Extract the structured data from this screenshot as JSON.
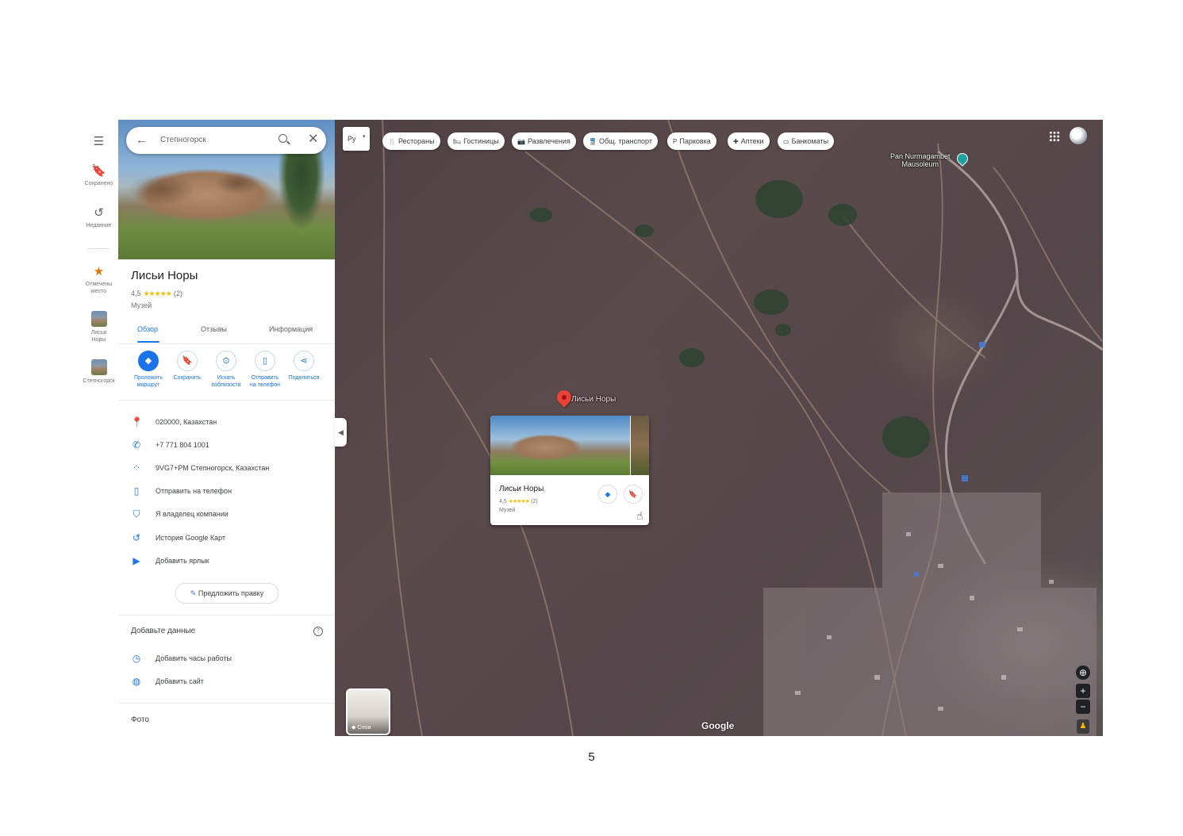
{
  "rail": {
    "menu_icon": "hamburger-menu-icon",
    "saved_label": "Сохранено",
    "recent_label": "Недавние",
    "marked_label": "Отмечены место",
    "place1_label": "Лисьи Норы",
    "place2_label": "Степногорск"
  },
  "search": {
    "query": "Степногорск"
  },
  "place": {
    "title": "Лисьи Норы",
    "rating": "4,5",
    "stars": "★★★★★",
    "review_count": "(2)",
    "category": "Музей"
  },
  "tabs": [
    "Обзор",
    "Отзывы",
    "Информация"
  ],
  "actions": [
    {
      "label1": "Проложить",
      "label2": "маршрут"
    },
    {
      "label1": "Сохранить",
      "label2": ""
    },
    {
      "label1": "Искать",
      "label2": "поблизости"
    },
    {
      "label1": "Отправить",
      "label2": "на телефон"
    },
    {
      "label1": "Поделиться",
      "label2": ""
    }
  ],
  "info": [
    {
      "icon": "location-pin-icon",
      "text": "020000, Казахстан"
    },
    {
      "icon": "phone-icon",
      "text": "+7 771 804 1001"
    },
    {
      "icon": "plus-code-icon",
      "text": "9VG7+PM Степногорск, Казахстан"
    },
    {
      "icon": "send-to-phone-icon",
      "text": "Отправить на телефон"
    },
    {
      "icon": "verified-shield-icon",
      "text": "Я владелец компании"
    },
    {
      "icon": "history-icon",
      "text": "История Google Карт"
    },
    {
      "icon": "label-tag-icon",
      "text": "Добавить ярлык"
    }
  ],
  "suggest_edit": "Предложить правку",
  "add_data": {
    "heading": "Добавьте данные",
    "items": [
      {
        "icon": "clock-icon",
        "text": "Добавить часы работы"
      },
      {
        "icon": "globe-icon",
        "text": "Добавить сайт"
      }
    ]
  },
  "photos_heading": "Фото",
  "map": {
    "input_tool": "Ру",
    "chips": [
      {
        "icon": "restaurant-icon",
        "glyph": "🍴",
        "label": "Рестораны"
      },
      {
        "icon": "hotel-icon",
        "glyph": "🛏",
        "label": "Гостиницы"
      },
      {
        "icon": "camera-icon",
        "glyph": "📷",
        "label": "Развлечения"
      },
      {
        "icon": "transit-icon",
        "glyph": "🚆",
        "label": "Общ. транспорт"
      },
      {
        "icon": "parking-icon",
        "glyph": "P",
        "label": "Парковка"
      },
      {
        "icon": "pharmacy-icon",
        "glyph": "✚",
        "label": "Аптеки"
      },
      {
        "icon": "atm-icon",
        "glyph": "▭",
        "label": "Банкоматы"
      }
    ],
    "poi_label_line1": "Pan Nurmagambet",
    "poi_label_line2": "Mausoleum",
    "pin_label": "Лисьи Норы",
    "card": {
      "title": "Лисьи Норы",
      "rating": "4,5",
      "stars": "★★★★★",
      "review_count": "(2)",
      "category": "Музей"
    },
    "layers_label": "Слои",
    "attribution": "Google"
  },
  "page_number": "5"
}
